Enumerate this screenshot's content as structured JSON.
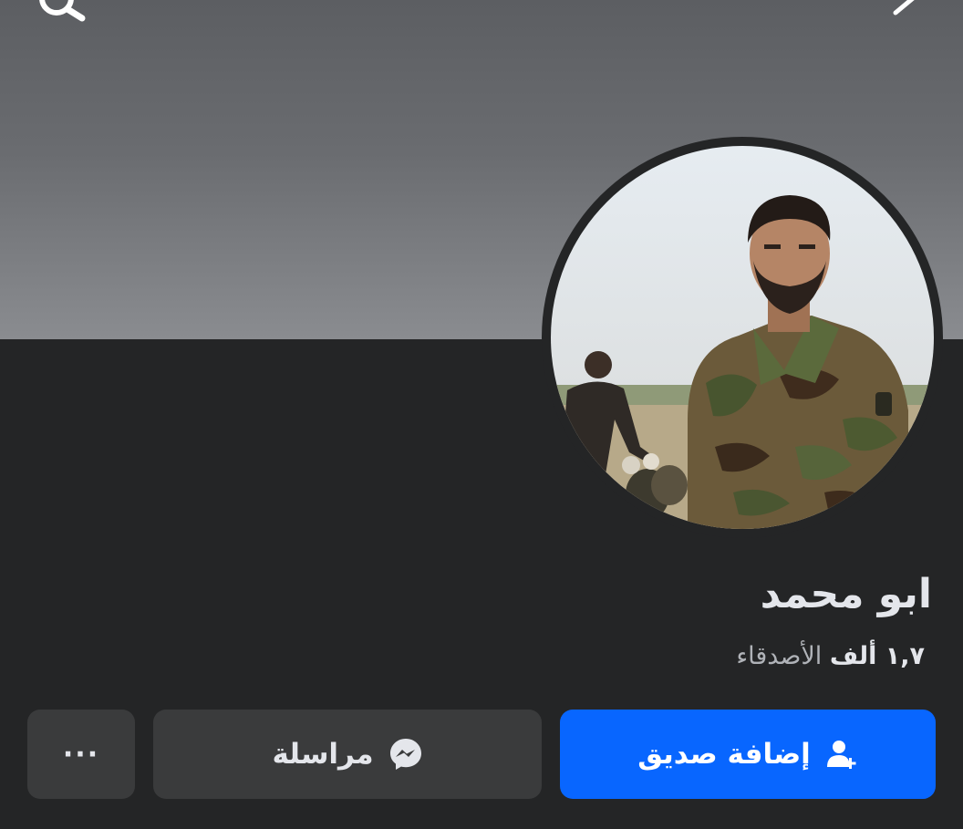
{
  "header": {
    "search_icon": "search-icon",
    "back_icon": "chevron-icon"
  },
  "profile": {
    "name": "ابو محمد",
    "friends_count": "١,٧ ألف",
    "friends_label": "الأصدقاء"
  },
  "actions": {
    "add_friend_label": "إضافة صديق",
    "message_label": "مراسلة",
    "more_label": "···"
  },
  "colors": {
    "background": "#242526",
    "primary": "#0866ff",
    "secondary_button": "#3a3b3c",
    "text_primary": "#e4e6eb",
    "text_secondary": "#b0b3b8"
  }
}
